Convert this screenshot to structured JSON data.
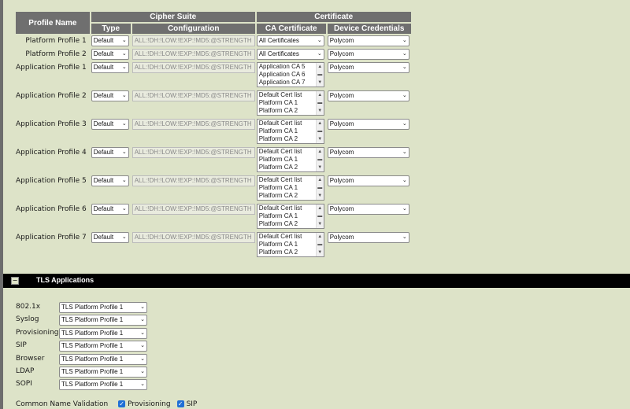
{
  "headers": {
    "profile_name": "Profile Name",
    "cipher_suite": "Cipher Suite",
    "certificate": "Certificate",
    "type": "Type",
    "configuration": "Configuration",
    "ca_certificate": "CA Certificate",
    "device_credentials": "Device Credentials"
  },
  "profiles": [
    {
      "name": "Platform Profile 1",
      "type": "Default",
      "config": "ALL:!DH:!LOW:!EXP:!MD5:@STRENGTH",
      "ca_kind": "select",
      "ca": [
        "All Certificates"
      ],
      "cred": "Polycom"
    },
    {
      "name": "Platform Profile 2",
      "type": "Default",
      "config": "ALL:!DH:!LOW:!EXP:!MD5:@STRENGTH",
      "ca_kind": "select",
      "ca": [
        "All Certificates"
      ],
      "cred": "Polycom"
    },
    {
      "name": "Application Profile 1",
      "type": "Default",
      "config": "ALL:!DH:!LOW:!EXP:!MD5:@STRENGTH",
      "ca_kind": "list",
      "ca": [
        "Application CA 5",
        "Application CA 6",
        "Application CA 7"
      ],
      "cred": "Polycom"
    },
    {
      "name": "Application Profile 2",
      "type": "Default",
      "config": "ALL:!DH:!LOW:!EXP:!MD5:@STRENGTH",
      "ca_kind": "list",
      "ca": [
        "Default Cert list",
        "Platform CA 1",
        "Platform CA 2"
      ],
      "cred": "Polycom"
    },
    {
      "name": "Application Profile 3",
      "type": "Default",
      "config": "ALL:!DH:!LOW:!EXP:!MD5:@STRENGTH",
      "ca_kind": "list",
      "ca": [
        "Default Cert list",
        "Platform CA 1",
        "Platform CA 2"
      ],
      "cred": "Polycom"
    },
    {
      "name": "Application Profile 4",
      "type": "Default",
      "config": "ALL:!DH:!LOW:!EXP:!MD5:@STRENGTH",
      "ca_kind": "list",
      "ca": [
        "Default Cert list",
        "Platform CA 1",
        "Platform CA 2"
      ],
      "cred": "Polycom"
    },
    {
      "name": "Application Profile 5",
      "type": "Default",
      "config": "ALL:!DH:!LOW:!EXP:!MD5:@STRENGTH",
      "ca_kind": "list",
      "ca": [
        "Default Cert list",
        "Platform CA 1",
        "Platform CA 2"
      ],
      "cred": "Polycom"
    },
    {
      "name": "Application Profile 6",
      "type": "Default",
      "config": "ALL:!DH:!LOW:!EXP:!MD5:@STRENGTH",
      "ca_kind": "list",
      "ca": [
        "Default Cert list",
        "Platform CA 1",
        "Platform CA 2"
      ],
      "cred": "Polycom"
    },
    {
      "name": "Application Profile 7",
      "type": "Default",
      "config": "ALL:!DH:!LOW:!EXP:!MD5:@STRENGTH",
      "ca_kind": "list",
      "ca": [
        "Default Cert list",
        "Platform CA 1",
        "Platform CA 2"
      ],
      "cred": "Polycom"
    }
  ],
  "tls_section": {
    "toggle": "−",
    "title": "TLS Applications",
    "apps": [
      {
        "label": "802.1x",
        "value": "TLS Platform Profile 1"
      },
      {
        "label": "Syslog",
        "value": "TLS Platform Profile 1"
      },
      {
        "label": "Provisioning",
        "value": "TLS Platform Profile 1"
      },
      {
        "label": "SIP",
        "value": "TLS Platform Profile 1"
      },
      {
        "label": "Browser",
        "value": "TLS Platform Profile 1"
      },
      {
        "label": "LDAP",
        "value": "TLS Platform Profile 1"
      },
      {
        "label": "SOPI",
        "value": "TLS Platform Profile 1"
      }
    ]
  },
  "common_name_validation": {
    "label": "Common Name Validation",
    "options": [
      {
        "label": "Provisioning",
        "checked": true
      },
      {
        "label": "SIP",
        "checked": true
      }
    ]
  },
  "icons": {
    "dropdown": "chevron-down-icon",
    "checkbox": "checkmark-icon",
    "scroll_up": "scroll-up-icon",
    "scroll_down": "scroll-down-icon"
  }
}
